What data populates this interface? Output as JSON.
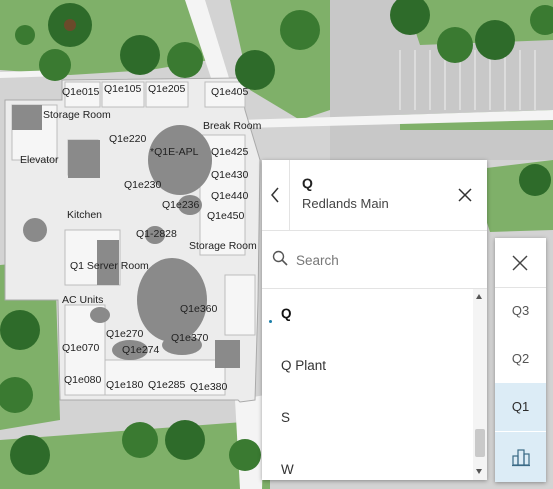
{
  "map": {
    "labels": [
      "Q1e015",
      "Q1e105",
      "Q1e205",
      "Q1e405",
      "Storage Room",
      "Break Room",
      "Q1e220",
      "*Q1E-APL",
      "Q1e425",
      "Elevator",
      "Q1e230",
      "Q1e430",
      "Q1e440",
      "Q1e236",
      "Kitchen",
      "Q1e450",
      "Q1-2828",
      "Storage Room",
      "Q1 Server Room",
      "AC Units",
      "Q1e360",
      "Q1e270",
      "Q1e370",
      "Q1e070",
      "Q1e274",
      "Q1e080",
      "Q1e180",
      "Q1e285",
      "Q1e380"
    ]
  },
  "panel": {
    "title": "Q",
    "subtitle": "Redlands Main",
    "search_placeholder": "Search",
    "list": [
      "Q",
      "Q Plant",
      "S",
      "W"
    ],
    "active_index": 0
  },
  "floor_selector": {
    "floors": [
      "Q3",
      "Q2",
      "Q1"
    ],
    "selected": "Q1"
  }
}
